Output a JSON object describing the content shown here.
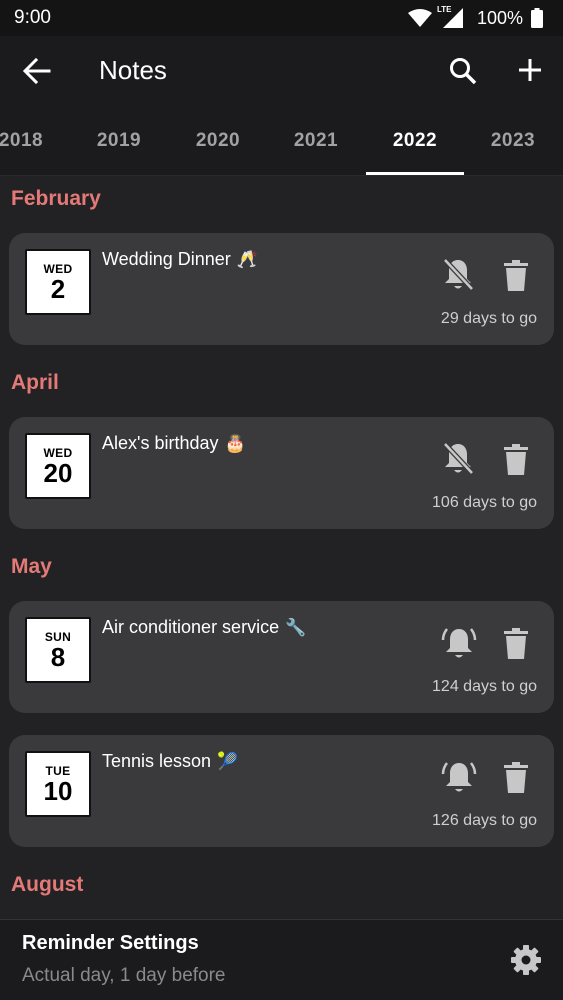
{
  "status_bar": {
    "time": "9:00",
    "network": "LTE",
    "battery": "100%"
  },
  "app_bar": {
    "title": "Notes",
    "icons": [
      "back-arrow-icon",
      "search-icon",
      "add-icon"
    ]
  },
  "year_tabs": {
    "items": [
      "2018",
      "2019",
      "2020",
      "2021",
      "2022",
      "2023"
    ],
    "selected": "2022"
  },
  "months": [
    "February",
    "April",
    "May",
    "August"
  ],
  "events": [
    {
      "weekday": "WED",
      "day": "2",
      "title": "Wedding Dinner",
      "emoji": "🥂",
      "reminder": "off",
      "countdown": "29 days to go"
    },
    {
      "weekday": "WED",
      "day": "20",
      "title": "Alex's birthday",
      "emoji": "🎂",
      "reminder": "off",
      "countdown": "106 days to go"
    },
    {
      "weekday": "SUN",
      "day": "8",
      "title": "Air conditioner service",
      "emoji": "🔧",
      "reminder": "on",
      "countdown": "124 days to go"
    },
    {
      "weekday": "TUE",
      "day": "10",
      "title": "Tennis lesson",
      "emoji": "🎾",
      "reminder": "on",
      "countdown": "126 days to go"
    }
  ],
  "bottom_bar": {
    "title": "Reminder Settings",
    "subtitle": "Actual day, 1 day before"
  },
  "colors": {
    "background": "#222123",
    "card": "#3a393b",
    "accent_month": "#e47a78",
    "tab_active": "#ffffff",
    "tab_inactive": "#a2a2a2"
  }
}
